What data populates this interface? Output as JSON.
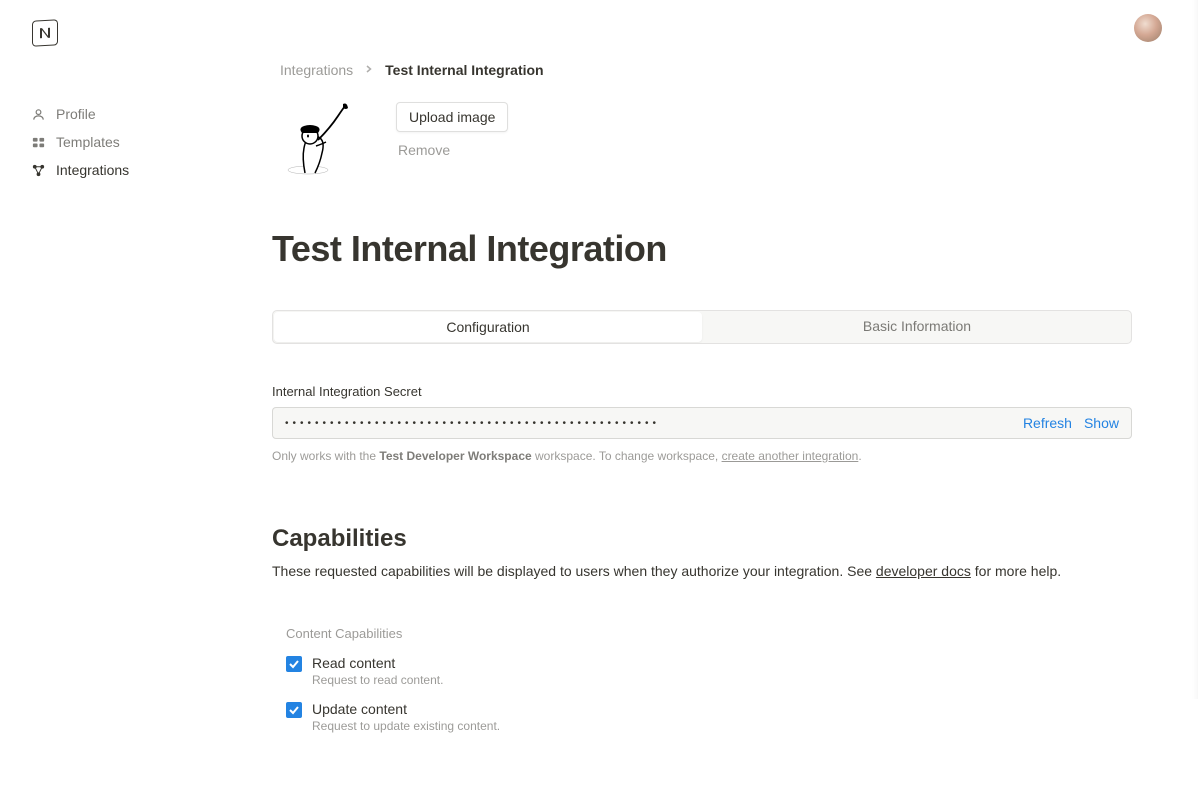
{
  "sidebar": {
    "items": [
      {
        "label": "Profile"
      },
      {
        "label": "Templates"
      },
      {
        "label": "Integrations"
      }
    ]
  },
  "breadcrumb": {
    "root": "Integrations",
    "current": "Test Internal Integration"
  },
  "imageActions": {
    "upload": "Upload image",
    "remove": "Remove"
  },
  "pageTitle": "Test Internal Integration",
  "tabs": {
    "configuration": "Configuration",
    "basicInfo": "Basic Information"
  },
  "secret": {
    "label": "Internal Integration Secret",
    "masked": "••••••••••••••••••••••••••••••••••••••••••••••••••",
    "refresh": "Refresh",
    "show": "Show",
    "helperPrefix": "Only works with the ",
    "helperBold": "Test Developer Workspace",
    "helperMid": " workspace. To change workspace, ",
    "helperLink": "create another integration",
    "helperSuffix": "."
  },
  "capabilities": {
    "title": "Capabilities",
    "descPrefix": "These requested capabilities will be displayed to users when they authorize your integration. See ",
    "descLink": "developer docs",
    "descSuffix": " for more help.",
    "groupTitle": "Content Capabilities",
    "items": [
      {
        "label": "Read content",
        "desc": "Request to read content."
      },
      {
        "label": "Update content",
        "desc": "Request to update existing content."
      }
    ]
  }
}
